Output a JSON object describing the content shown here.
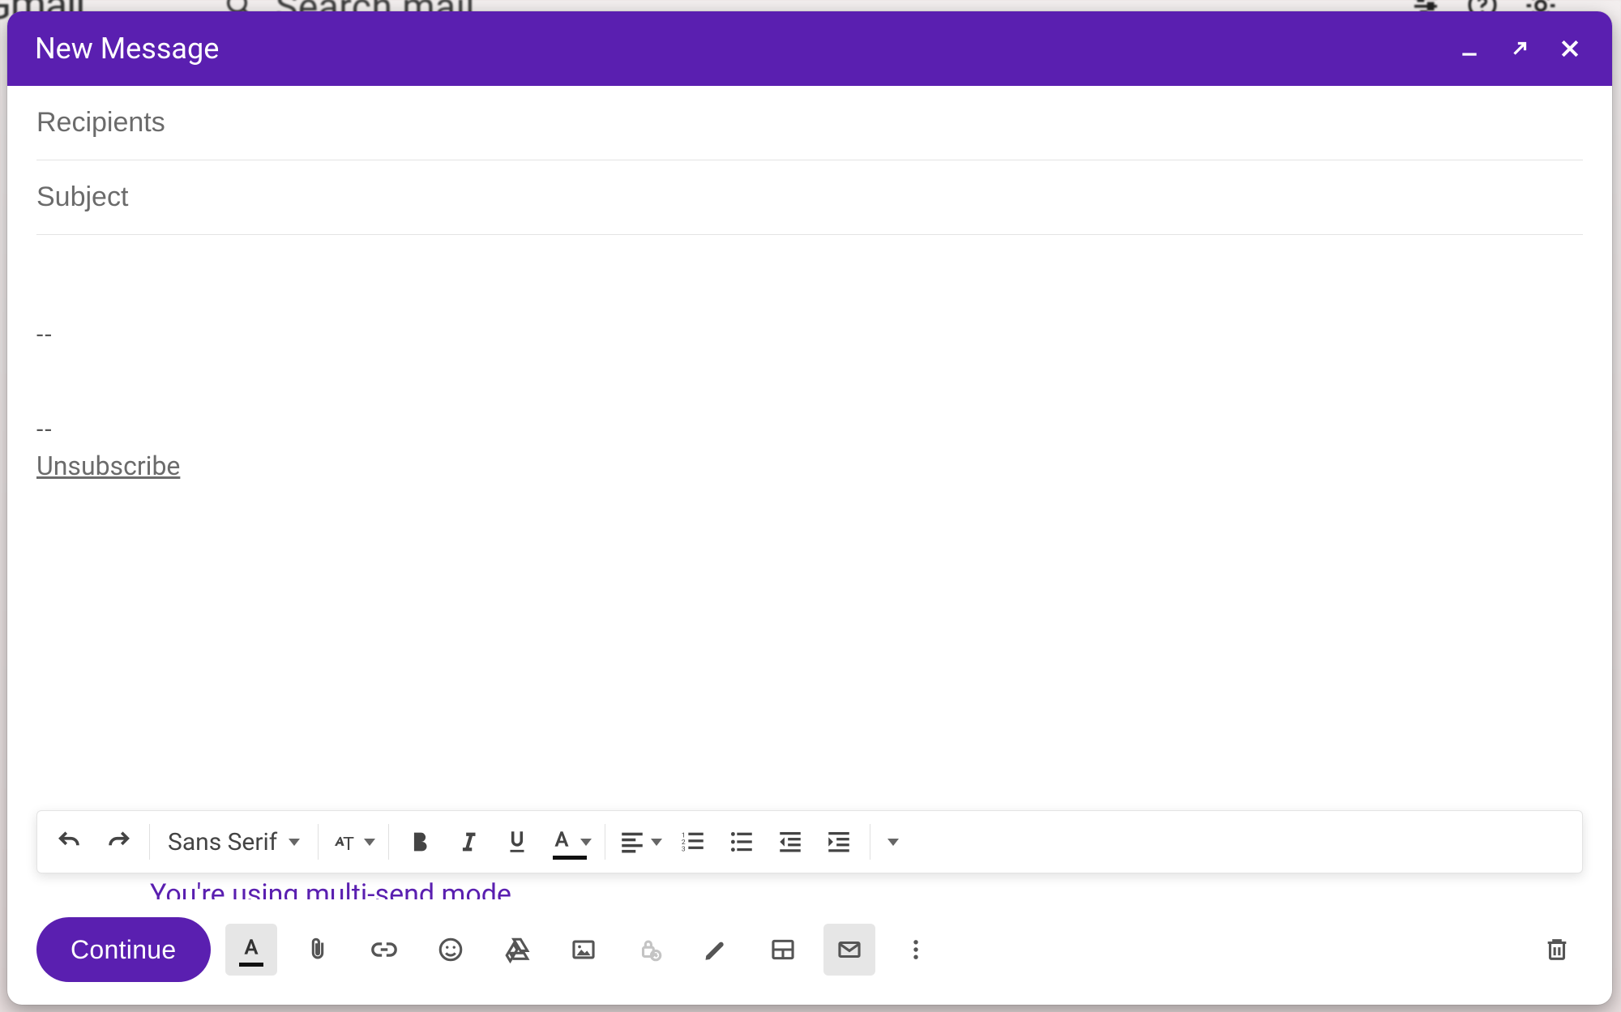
{
  "backdrop": {
    "logo_text": "Gmail",
    "search_placeholder": "Search mail"
  },
  "titlebar": {
    "title": "New Message"
  },
  "fields": {
    "recipients_placeholder": "Recipients",
    "subject_placeholder": "Subject"
  },
  "body": {
    "separator1": "--",
    "separator2": "--",
    "unsubscribe": "Unsubscribe",
    "multi_send_note": "You're using multi-send mode"
  },
  "format_toolbar": {
    "font_name": "Sans Serif"
  },
  "bottom": {
    "continue_label": "Continue"
  },
  "colors": {
    "accent": "#5a1fb0"
  }
}
